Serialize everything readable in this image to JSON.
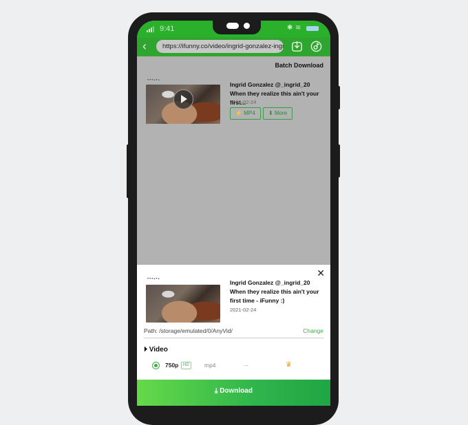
{
  "status_bar": {
    "time": "9:41"
  },
  "toolbar": {
    "url": "https://ifunny.co/video/ingrid-gonzalez-ingrid-",
    "icons": [
      "back-icon",
      "download-icon",
      "tiktok-icon"
    ]
  },
  "page": {
    "batch_download_label": "Batch Download",
    "video": {
      "title": "Ingrid Gonzalez @_ingrid_20 When they realize this ain't your first...",
      "date": "2021-02-24",
      "mp4_label": "MP4",
      "more_label": "More"
    }
  },
  "sheet": {
    "title": "Ingrid Gonzalez @_ingrid_20 When they realize this ain't your first time - iFunny :)",
    "date": "2021-02-24",
    "path": "Path: /storage/emulated/0/AnyVid/",
    "change_label": "Change",
    "section_label": "Video",
    "option": {
      "resolution": "750p",
      "badge": "HD",
      "format": "mp4",
      "size": "--",
      "selected": true,
      "premium": true
    },
    "download_label": "Download"
  },
  "colors": {
    "brand_green": "#2ea52e",
    "accent_green": "#3cb043",
    "premium_gold": "#f0a020"
  }
}
